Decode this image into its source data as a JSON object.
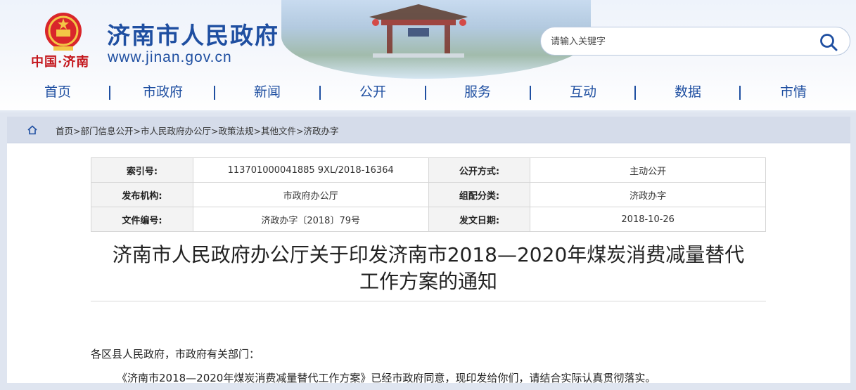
{
  "header": {
    "site_title": "济南市人民政府",
    "site_url": "www.jinan.gov.cn",
    "region_label": "中国·济南",
    "search": {
      "placeholder": "请输入关键字"
    }
  },
  "nav": {
    "items": [
      {
        "label": "首页"
      },
      {
        "label": "市政府"
      },
      {
        "label": "新闻"
      },
      {
        "label": "公开"
      },
      {
        "label": "服务"
      },
      {
        "label": "互动"
      },
      {
        "label": "数据"
      },
      {
        "label": "市情"
      }
    ]
  },
  "breadcrumb": {
    "items": [
      "首页",
      "部门信息公开",
      "市人民政府办公厅",
      "政策法规",
      "其他文件",
      "济政办字"
    ],
    "separator": ">"
  },
  "meta_table": {
    "rows": [
      [
        {
          "key": "索引号:",
          "value": "113701000041885 9XL/2018-16364"
        },
        {
          "key": "公开方式:",
          "value": "主动公开"
        }
      ],
      [
        {
          "key": "发布机构:",
          "value": "市政府办公厅"
        },
        {
          "key": "组配分类:",
          "value": "济政办字"
        }
      ],
      [
        {
          "key": "文件编号:",
          "value": "济政办字〔2018〕79号"
        },
        {
          "key": "发文日期:",
          "value": "2018-10-26"
        }
      ]
    ]
  },
  "document": {
    "title_line1": "济南市人民政府办公厅关于印发济南市2018—2020年煤炭消费减量替代",
    "title_line2": "工作方案的通知",
    "salutation": "各区县人民政府，市政府有关部门：",
    "paragraph1": "《济南市2018—2020年煤炭消费减量替代工作方案》已经市政府同意，现印发给你们，请结合实际认真贯彻落实。"
  },
  "colors": {
    "brand_blue": "#1f4fa1",
    "emblem_red": "#c4161c",
    "breadcrumb_bg": "#d5dcea"
  },
  "icons": {
    "search": "search-icon",
    "home": "home-icon",
    "emblem": "national-emblem-icon"
  }
}
